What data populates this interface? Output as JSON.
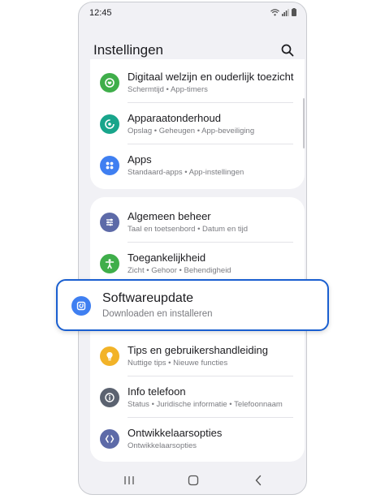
{
  "status_bar": {
    "time": "12:45"
  },
  "header": {
    "title": "Instellingen"
  },
  "groups": [
    {
      "items": [
        {
          "title": "Digitaal welzijn en ouderlijk toezicht",
          "subtitle": "Schermtijd  •  App-timers",
          "color": "#3fae4a"
        },
        {
          "title": "Apparaatonderhoud",
          "subtitle": "Opslag  •  Geheugen  •  App-beveiliging",
          "color": "#18a58b"
        },
        {
          "title": "Apps",
          "subtitle": "Standaard-apps  •  App-instellingen",
          "color": "#3f7ff1"
        }
      ]
    },
    {
      "items": [
        {
          "title": "Algemeen beheer",
          "subtitle": "Taal en toetsenbord  •  Datum en tijd",
          "color": "#5d6aa8"
        },
        {
          "title": "Toegankelijkheid",
          "subtitle": "Zicht  •  Gehoor  •  Behendigheid",
          "color": "#3fae4a"
        },
        {
          "title": "Softwareupdate",
          "subtitle": "Downloaden en installeren",
          "color": "#3f7ff1"
        },
        {
          "title": "Tips en gebruikershandleiding",
          "subtitle": "Nuttige tips  •  Nieuwe functies",
          "color": "#f2b328"
        },
        {
          "title": "Info telefoon",
          "subtitle": "Status  •  Juridische informatie  •  Telefoonnaam",
          "color": "#5b6270"
        },
        {
          "title": "Ontwikkelaarsopties",
          "subtitle": "Ontwikkelaarsopties",
          "color": "#5d6aa8"
        }
      ]
    }
  ]
}
